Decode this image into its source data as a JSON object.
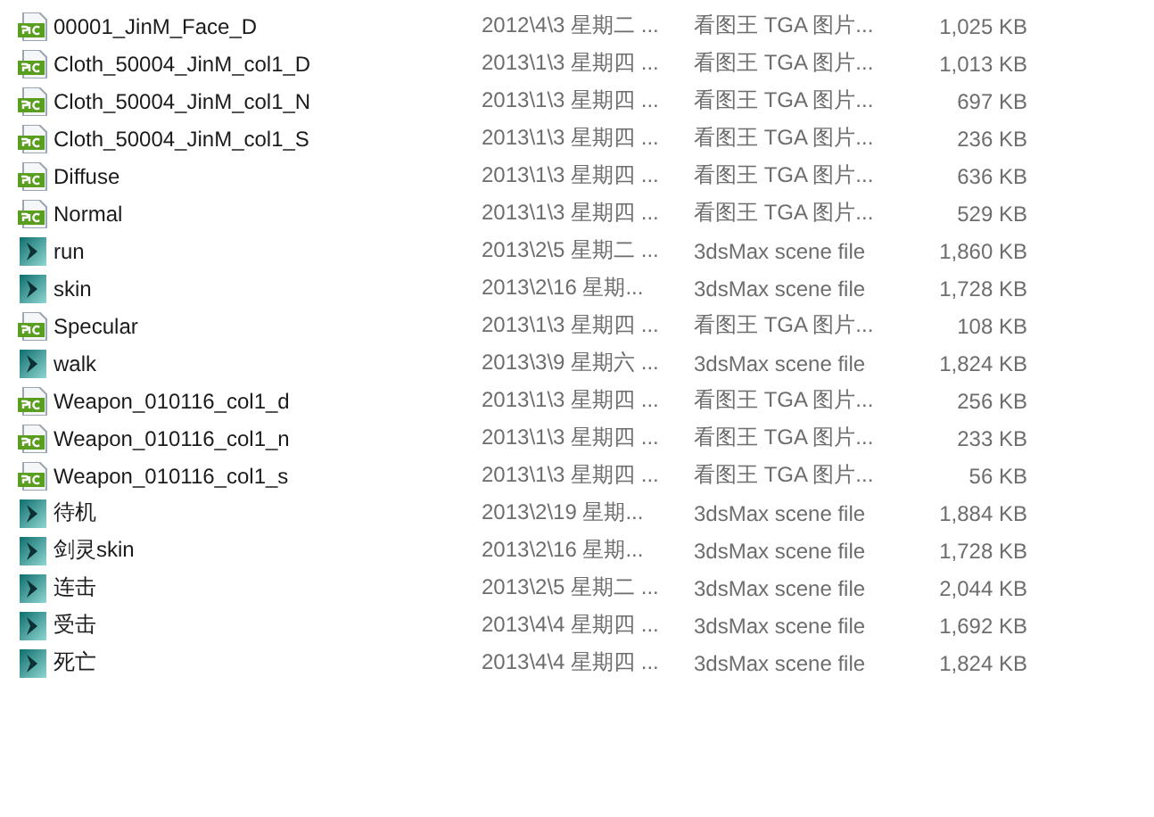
{
  "files": [
    {
      "kind": "pic",
      "name": "00001_JinM_Face_D",
      "date": "2012\\4\\3 星期二 ...",
      "type": "看图王 TGA 图片...",
      "size": "1,025 KB"
    },
    {
      "kind": "pic",
      "name": "Cloth_50004_JinM_col1_D",
      "date": "2013\\1\\3 星期四 ...",
      "type": "看图王 TGA 图片...",
      "size": "1,013 KB"
    },
    {
      "kind": "pic",
      "name": "Cloth_50004_JinM_col1_N",
      "date": "2013\\1\\3 星期四 ...",
      "type": "看图王 TGA 图片...",
      "size": "697 KB"
    },
    {
      "kind": "pic",
      "name": "Cloth_50004_JinM_col1_S",
      "date": "2013\\1\\3 星期四 ...",
      "type": "看图王 TGA 图片...",
      "size": "236 KB"
    },
    {
      "kind": "pic",
      "name": "Diffuse",
      "date": "2013\\1\\3 星期四 ...",
      "type": "看图王 TGA 图片...",
      "size": "636 KB"
    },
    {
      "kind": "pic",
      "name": "Normal",
      "date": "2013\\1\\3 星期四 ...",
      "type": "看图王 TGA 图片...",
      "size": "529 KB"
    },
    {
      "kind": "max",
      "name": "run",
      "date": "2013\\2\\5 星期二 ...",
      "type": "3dsMax scene file",
      "size": "1,860 KB"
    },
    {
      "kind": "max",
      "name": "skin",
      "date": "2013\\2\\16 星期...",
      "type": "3dsMax scene file",
      "size": "1,728 KB"
    },
    {
      "kind": "pic",
      "name": "Specular",
      "date": "2013\\1\\3 星期四 ...",
      "type": "看图王 TGA 图片...",
      "size": "108 KB"
    },
    {
      "kind": "max",
      "name": "walk",
      "date": "2013\\3\\9 星期六 ...",
      "type": "3dsMax scene file",
      "size": "1,824 KB"
    },
    {
      "kind": "pic",
      "name": "Weapon_010116_col1_d",
      "date": "2013\\1\\3 星期四 ...",
      "type": "看图王 TGA 图片...",
      "size": "256 KB"
    },
    {
      "kind": "pic",
      "name": "Weapon_010116_col1_n",
      "date": "2013\\1\\3 星期四 ...",
      "type": "看图王 TGA 图片...",
      "size": "233 KB"
    },
    {
      "kind": "pic",
      "name": "Weapon_010116_col1_s",
      "date": "2013\\1\\3 星期四 ...",
      "type": "看图王 TGA 图片...",
      "size": "56 KB"
    },
    {
      "kind": "max",
      "name": "待机",
      "date": "2013\\2\\19 星期...",
      "type": "3dsMax scene file",
      "size": "1,884 KB"
    },
    {
      "kind": "max",
      "name": "剑灵skin",
      "date": "2013\\2\\16 星期...",
      "type": "3dsMax scene file",
      "size": "1,728 KB"
    },
    {
      "kind": "max",
      "name": "连击",
      "date": "2013\\2\\5 星期二 ...",
      "type": "3dsMax scene file",
      "size": "2,044 KB"
    },
    {
      "kind": "max",
      "name": "受击",
      "date": "2013\\4\\4 星期四 ...",
      "type": "3dsMax scene file",
      "size": "1,692 KB"
    },
    {
      "kind": "max",
      "name": "死亡",
      "date": "2013\\4\\4 星期四 ...",
      "type": "3dsMax scene file",
      "size": "1,824 KB"
    }
  ]
}
